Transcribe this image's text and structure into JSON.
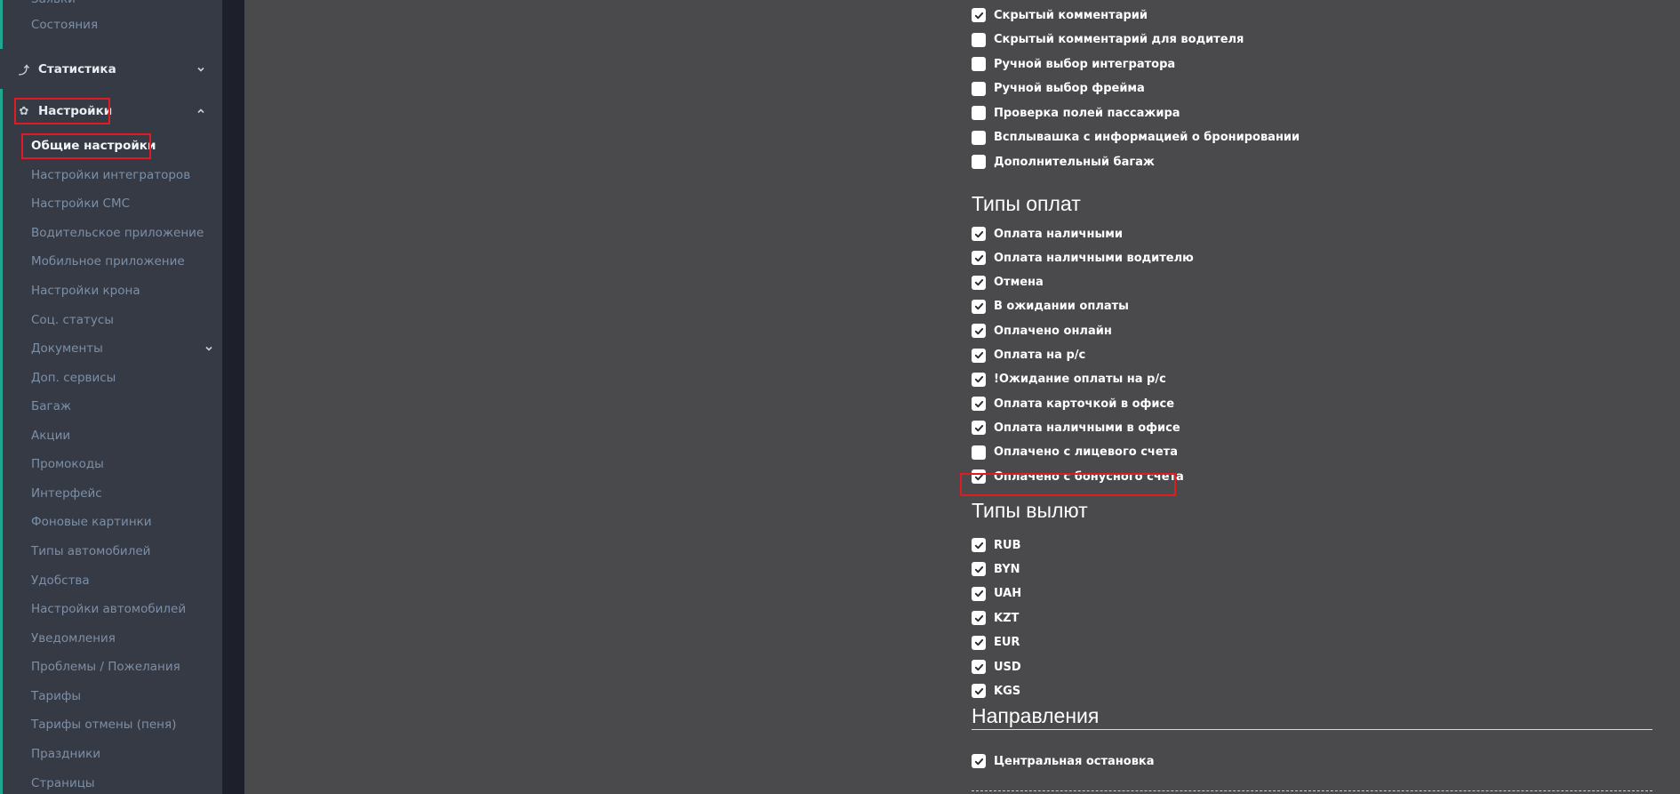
{
  "sidebar": {
    "top_items": [
      {
        "label": "Заявки"
      },
      {
        "label": "Состояния"
      }
    ],
    "sections": {
      "statistics": {
        "label": "Статистика",
        "icon": "chart-icon"
      },
      "settings": {
        "label": "Настройки",
        "icon": "gear-icon"
      }
    },
    "settings_items": [
      {
        "label": "Общие настройки",
        "active": true
      },
      {
        "label": "Настройки интеграторов"
      },
      {
        "label": "Настройки СМС"
      },
      {
        "label": "Водительское приложение"
      },
      {
        "label": "Мобильное приложение"
      },
      {
        "label": "Настройки крона"
      },
      {
        "label": "Соц. статусы"
      },
      {
        "label": "Документы",
        "has_submenu": true
      },
      {
        "label": "Доп. сервисы"
      },
      {
        "label": "Багаж"
      },
      {
        "label": "Акции"
      },
      {
        "label": "Промокоды"
      },
      {
        "label": "Интерфейс"
      },
      {
        "label": "Фоновые картинки"
      },
      {
        "label": "Типы автомобилей"
      },
      {
        "label": "Удобства"
      },
      {
        "label": "Настройки автомобилей"
      },
      {
        "label": "Уведомления"
      },
      {
        "label": "Проблемы / Пожелания"
      },
      {
        "label": "Тарифы"
      },
      {
        "label": "Тарифы отмены (пеня)"
      },
      {
        "label": "Праздники"
      },
      {
        "label": "Страницы"
      }
    ]
  },
  "main": {
    "options": [
      {
        "label": "Скрытый комментарий",
        "checked": true
      },
      {
        "label": "Скрытый комментарий для водителя",
        "checked": false
      },
      {
        "label": "Ручной выбор интегратора",
        "checked": false
      },
      {
        "label": "Ручной выбор фрейма",
        "checked": false
      },
      {
        "label": "Проверка полей пассажира",
        "checked": false
      },
      {
        "label": "Всплывашка с информацией о бронировании",
        "checked": false
      },
      {
        "label": "Дополнительный багаж",
        "checked": false
      }
    ],
    "payment_types": {
      "title": "Типы оплат",
      "items": [
        {
          "label": "Оплата наличными",
          "checked": true
        },
        {
          "label": "Оплата наличными водителю",
          "checked": true
        },
        {
          "label": "Отмена",
          "checked": true
        },
        {
          "label": "В ожидании оплаты",
          "checked": true
        },
        {
          "label": "Оплачено онлайн",
          "checked": true
        },
        {
          "label": "Оплата на р/с",
          "checked": true
        },
        {
          "label": "!Ожидание оплаты на р/с",
          "checked": true
        },
        {
          "label": "Оплата карточкой в офисе",
          "checked": true
        },
        {
          "label": "Оплата наличными в офисе",
          "checked": true
        },
        {
          "label": "Оплачено с лицевого счета",
          "checked": false
        },
        {
          "label": "Оплачено с бонусного счета",
          "checked": true,
          "highlighted": true
        }
      ]
    },
    "currency_types": {
      "title": "Типы вылют",
      "items": [
        {
          "label": "RUB",
          "checked": true
        },
        {
          "label": "BYN",
          "checked": true
        },
        {
          "label": "UAH",
          "checked": true
        },
        {
          "label": "KZT",
          "checked": true
        },
        {
          "label": "EUR",
          "checked": true
        },
        {
          "label": "USD",
          "checked": true
        },
        {
          "label": "KGS",
          "checked": true
        }
      ]
    },
    "directions": {
      "title": "Направления",
      "items": [
        {
          "label": "Центральная остановка",
          "checked": true
        }
      ]
    }
  },
  "colors": {
    "sidebar_bg": "#353a45",
    "main_bg": "#4a4a4c",
    "accent": "#1fa88f",
    "highlight": "#e11b22",
    "sidebar_text": "#7d8fa6"
  }
}
